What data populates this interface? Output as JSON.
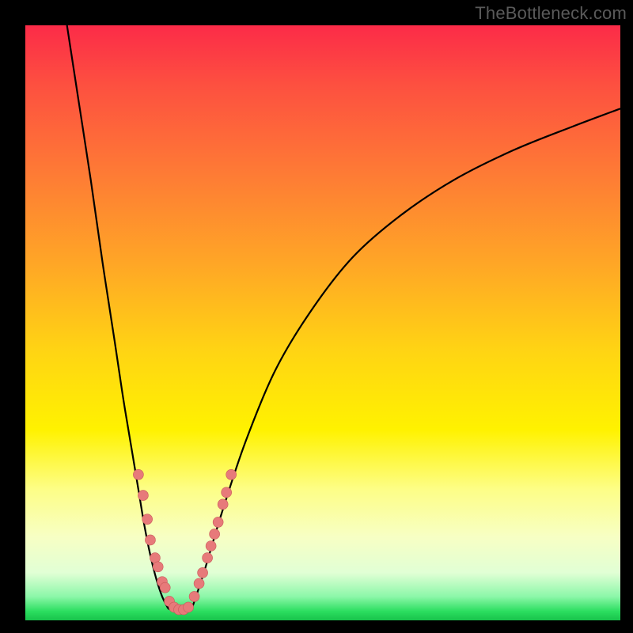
{
  "watermark": "TheBottleneck.com",
  "colors": {
    "frame_bg": "#000000",
    "gradient_top": "#fc2b48",
    "gradient_bottom": "#18c24b",
    "curve_stroke": "#000000",
    "bead_fill": "#e77a7a",
    "bead_stroke": "#c95a5a"
  },
  "chart_data": {
    "type": "line",
    "title": "",
    "xlabel": "",
    "ylabel": "",
    "xlim": [
      0,
      100
    ],
    "ylim": [
      0,
      100
    ],
    "grid": false,
    "legend_position": "none",
    "note": "Bottleneck-style V curve. x roughly = relative component rating (arbitrary 0-100). y = bottleneck severity (0 = none / green at bottom, 100 = worst / red at top). Values estimated from pixel positions; no axis ticks shown in source.",
    "series": [
      {
        "name": "left_branch",
        "x": [
          7,
          9,
          11,
          13,
          15,
          16.5,
          18,
          19,
          20,
          21,
          22,
          23,
          24
        ],
        "y": [
          100,
          87,
          74,
          60,
          47,
          37,
          28,
          22,
          16,
          11,
          7,
          4,
          2
        ]
      },
      {
        "name": "floor",
        "x": [
          24,
          25,
          26,
          27,
          28
        ],
        "y": [
          2,
          1.5,
          1.3,
          1.5,
          2
        ]
      },
      {
        "name": "right_branch",
        "x": [
          28,
          30,
          33,
          37,
          42,
          48,
          55,
          63,
          72,
          82,
          92,
          100
        ],
        "y": [
          2,
          8,
          18,
          30,
          42,
          52,
          61,
          68,
          74,
          79,
          83,
          86
        ]
      }
    ],
    "beads": {
      "note": "Pink marker dots overlaid near the valley, plot-space coords (same 0-100 axes).",
      "points": [
        {
          "x": 19.0,
          "y": 24.5
        },
        {
          "x": 19.8,
          "y": 21.0
        },
        {
          "x": 20.5,
          "y": 17.0
        },
        {
          "x": 21.0,
          "y": 13.5
        },
        {
          "x": 21.8,
          "y": 10.5
        },
        {
          "x": 22.3,
          "y": 9.0
        },
        {
          "x": 23.0,
          "y": 6.5
        },
        {
          "x": 23.5,
          "y": 5.5
        },
        {
          "x": 24.2,
          "y": 3.2
        },
        {
          "x": 25.0,
          "y": 2.2
        },
        {
          "x": 25.8,
          "y": 1.8
        },
        {
          "x": 26.6,
          "y": 1.8
        },
        {
          "x": 27.4,
          "y": 2.2
        },
        {
          "x": 28.4,
          "y": 4.0
        },
        {
          "x": 29.2,
          "y": 6.2
        },
        {
          "x": 29.8,
          "y": 8.0
        },
        {
          "x": 30.6,
          "y": 10.5
        },
        {
          "x": 31.2,
          "y": 12.5
        },
        {
          "x": 31.8,
          "y": 14.5
        },
        {
          "x": 32.4,
          "y": 16.5
        },
        {
          "x": 33.2,
          "y": 19.5
        },
        {
          "x": 33.8,
          "y": 21.5
        },
        {
          "x": 34.6,
          "y": 24.5
        }
      ],
      "radius_px": 6.5
    }
  }
}
